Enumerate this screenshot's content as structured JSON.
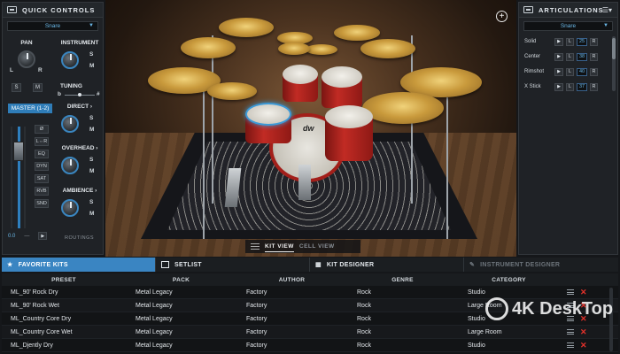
{
  "quick_controls": {
    "title": "QUICK CONTROLS",
    "instrument_select": "Snare",
    "pan_label": "PAN",
    "pan_l": "L",
    "pan_r": "R",
    "instrument_label": "INSTRUMENT",
    "s_label": "S",
    "m_label": "M",
    "tuning_label": "TUNING",
    "tuning_flat": "b",
    "tuning_sharp": "#",
    "master_label": "MASTER (1-2)",
    "direct_label": "DIRECT",
    "overhead_label": "OVERHEAD",
    "ambience_label": "AMBIENCE",
    "fx_buttons": [
      "Ø",
      "L⇔R",
      "EQ",
      "DYN",
      "SAT",
      "RVB",
      "SND"
    ],
    "fader_value": "0.0",
    "routings_label": "ROUTINGS"
  },
  "stage": {
    "kit_logo": "dw",
    "views": [
      "KIT VIEW",
      "CELL VIEW"
    ]
  },
  "articulations": {
    "title": "ARTICULATIONS",
    "instrument_select": "Snare",
    "rows": [
      {
        "name": "Solid",
        "value": "25"
      },
      {
        "name": "Center",
        "value": "38"
      },
      {
        "name": "Rimshot",
        "value": "40"
      },
      {
        "name": "X Stick",
        "value": "37"
      }
    ],
    "play_glyph": "▶",
    "l_label": "L",
    "r_label": "R"
  },
  "browser": {
    "tabs": [
      "FAVORITE KITS",
      "SETLIST",
      "KIT DESIGNER",
      "INSTRUMENT DESIGNER"
    ],
    "columns": [
      "PRESET",
      "PACK",
      "AUTHOR",
      "GENRE",
      "CATEGORY"
    ],
    "rows": [
      [
        "ML_90' Rock Dry",
        "Metal Legacy",
        "Factory",
        "Rock",
        "Studio"
      ],
      [
        "ML_90' Rock Wet",
        "Metal Legacy",
        "Factory",
        "Rock",
        "Large Room"
      ],
      [
        "ML_Country Core Dry",
        "Metal Legacy",
        "Factory",
        "Rock",
        "Studio"
      ],
      [
        "ML_Country Core Wet",
        "Metal Legacy",
        "Factory",
        "Rock",
        "Large Room"
      ],
      [
        "ML_Djently Dry",
        "Metal Legacy",
        "Factory",
        "Rock",
        "Studio"
      ]
    ],
    "delete_glyph": "✕"
  },
  "watermark": "4K DeskTop",
  "colors": {
    "accent": "#3a85c2",
    "delete": "#e3312b",
    "panel": "#1f2226"
  }
}
